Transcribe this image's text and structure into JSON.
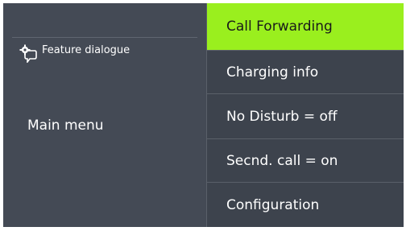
{
  "left_panel": {
    "feature_label": "Feature dialogue",
    "feature_icon": "feature-dialogue-icon",
    "main_menu_label": "Main menu"
  },
  "menu": {
    "items": [
      {
        "label": "Call Forwarding",
        "selected": true
      },
      {
        "label": "Charging info",
        "selected": false
      },
      {
        "label": "No Disturb = off",
        "selected": false
      },
      {
        "label": "Secnd. call = on",
        "selected": false
      },
      {
        "label": "Configuration",
        "selected": false
      }
    ]
  },
  "colors": {
    "background": "#444a55",
    "menu_background": "#3d434d",
    "selected": "#9aef1e",
    "text": "#ffffff"
  }
}
